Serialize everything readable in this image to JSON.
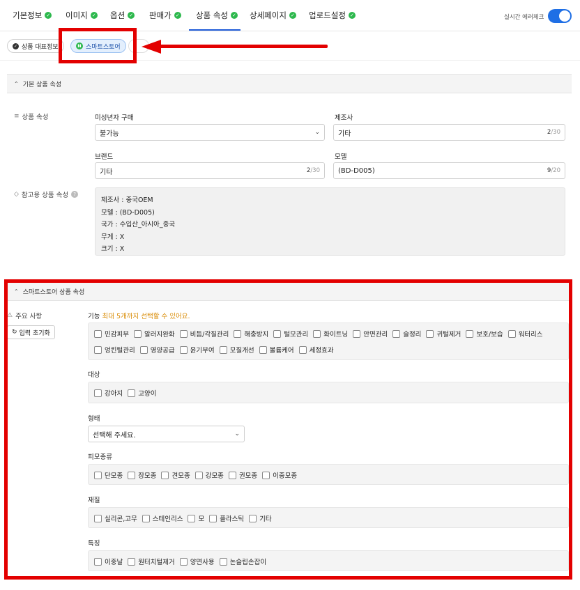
{
  "tabs": [
    {
      "label": "기본정보"
    },
    {
      "label": "이미지"
    },
    {
      "label": "옵션"
    },
    {
      "label": "판매가"
    },
    {
      "label": "상품 속성"
    },
    {
      "label": "상세페이지"
    },
    {
      "label": "업로드설정"
    }
  ],
  "realtime_check": {
    "label": "실시간 에러체크",
    "enabled": true
  },
  "chips": [
    {
      "label": "상품 대표정보"
    },
    {
      "label": "스마트스토어",
      "badge": "N"
    }
  ],
  "basic_section": {
    "title": "기본 상품 속성",
    "side_label": "상품 속성",
    "minor_purchase": {
      "label": "미성년자 구매",
      "value": "불가능"
    },
    "manufacturer": {
      "label": "제조사",
      "value": "기타",
      "count": "2",
      "max": "/30"
    },
    "brand": {
      "label": "브랜드",
      "value": "기타",
      "count": "2",
      "max": "/30"
    },
    "model": {
      "label": "모델",
      "value": "(BD-D005)",
      "count": "9",
      "max": "/20"
    },
    "reference_label": "참고용 상품 속성",
    "reference_lines": [
      "제조사 : 중국OEM",
      "모델 : (BD-D005)",
      "국가 : 수입산_아시아_중국",
      "무게 : X",
      "크기 : X"
    ]
  },
  "smartstore_section": {
    "title": "스마트스토어 상품 속성",
    "side_label": "주요 사항",
    "reset_label": "입력 초기화",
    "function": {
      "label": "기능",
      "hint": "최대 5개까지 선택할 수 있어요.",
      "row1": [
        "민감피부",
        "알러지완화",
        "비듬/각질관리",
        "해충방지",
        "털모관리",
        "화이트닝",
        "안면관리",
        "슬정리",
        "귀털제거",
        "보호/보습",
        "워터리스"
      ],
      "row2": [
        "엉킨털관리",
        "영양공급",
        "윤기부여",
        "모질개선",
        "볼륨케어",
        "세정효과"
      ]
    },
    "target": {
      "label": "대상",
      "options": [
        "강아지",
        "고양이"
      ]
    },
    "form": {
      "label": "형태",
      "placeholder": "선택해 주세요."
    },
    "fur_type": {
      "label": "피모종류",
      "options": [
        "단모종",
        "장모종",
        "견모종",
        "강모종",
        "권모종",
        "이중모종"
      ]
    },
    "material": {
      "label": "재질",
      "options": [
        "실리콘,고무",
        "스테인리스",
        "모",
        "플라스틱",
        "기타"
      ]
    },
    "feature": {
      "label": "특징",
      "options": [
        "이중날",
        "원터치털제거",
        "양면사용",
        "논슬립손잡이"
      ]
    }
  },
  "colors": {
    "accent": "#1f5bd8",
    "check": "#2db84d",
    "annotation_red": "#e30000",
    "hint": "#d98a00"
  }
}
